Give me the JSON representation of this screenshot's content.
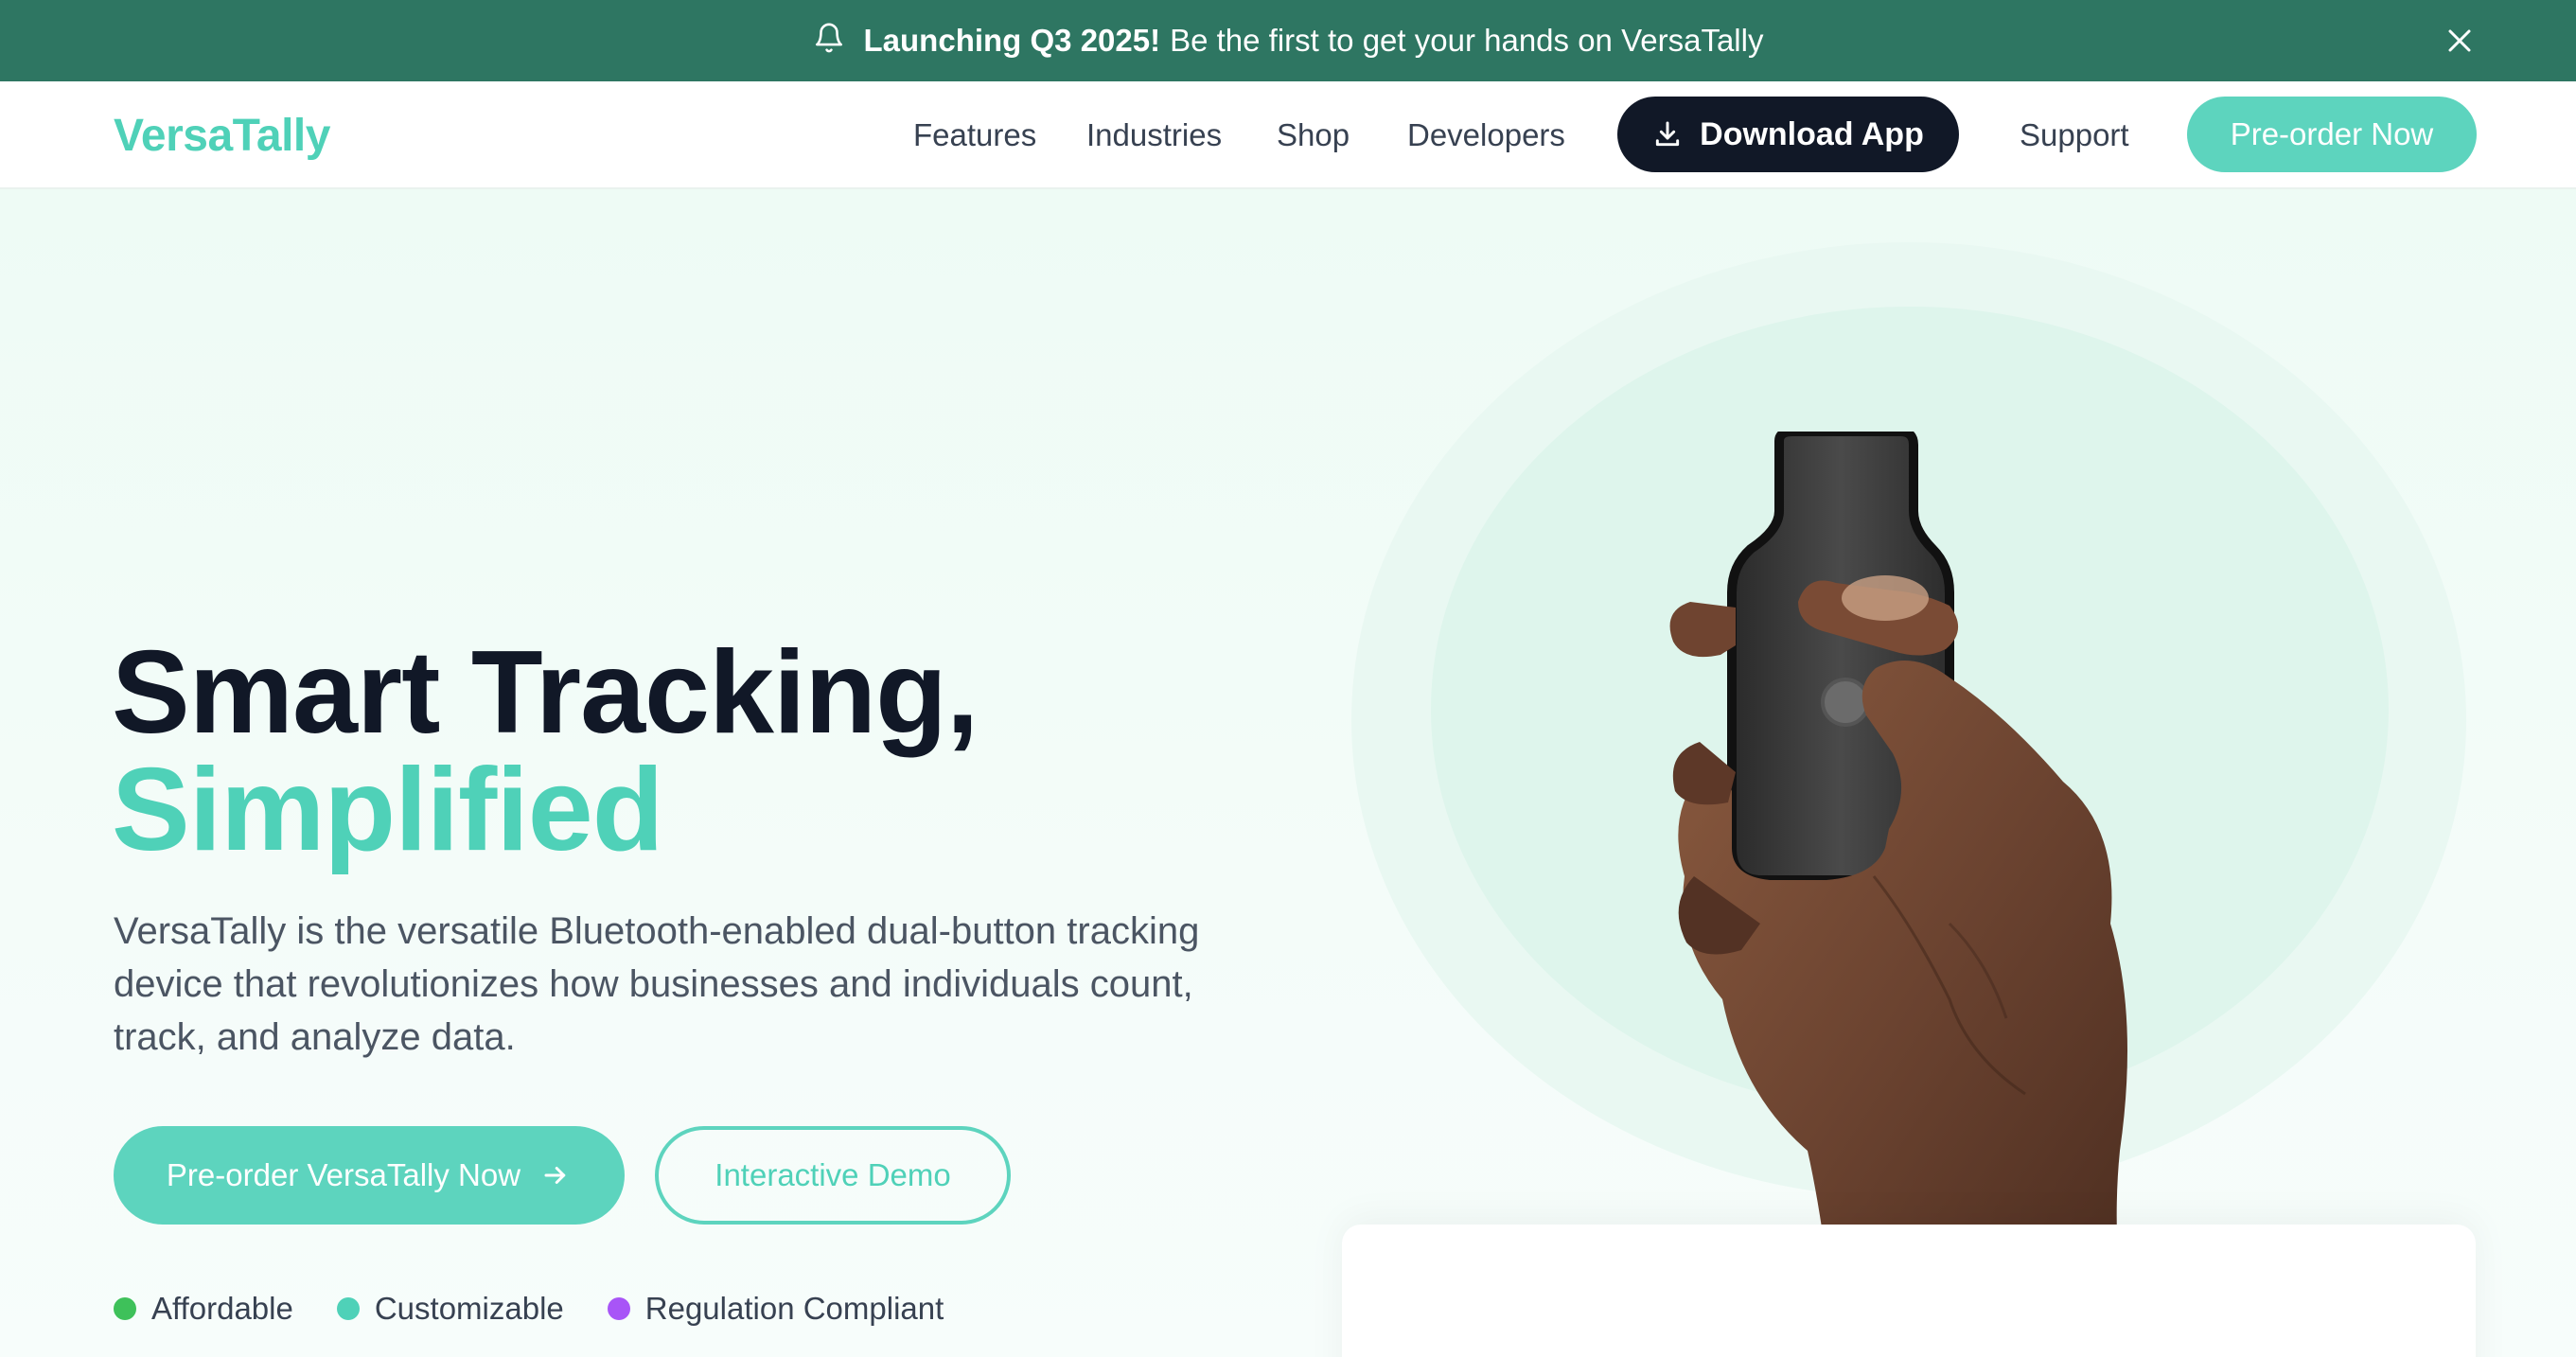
{
  "announcement": {
    "bold_text": "Launching Q3 2025!",
    "text": "Be the first to get your hands on VersaTally",
    "icon": "bell-icon",
    "close_icon": "close-icon"
  },
  "nav": {
    "logo": "VersaTally",
    "links": [
      "Features",
      "Industries",
      "Shop",
      "Developers"
    ],
    "download_label": "Download App",
    "support_label": "Support",
    "preorder_label": "Pre-order Now"
  },
  "hero": {
    "headline_line1": "Smart Tracking,",
    "headline_line2": "Simplified",
    "description": "VersaTally is the versatile Bluetooth-enabled dual-button tracking device that revolutionizes how businesses and individuals count, track, and analyze data.",
    "primary_cta": "Pre-order VersaTally Now",
    "secondary_cta": "Interactive Demo",
    "badges": [
      {
        "label": "Affordable",
        "color": "#3ec15a"
      },
      {
        "label": "Customizable",
        "color": "#4fd1b8"
      },
      {
        "label": "Regulation Compliant",
        "color": "#a855f7"
      }
    ]
  },
  "colors": {
    "brand": "#4fd1b8",
    "announce_bg": "#2e7662",
    "dark": "#111827"
  }
}
